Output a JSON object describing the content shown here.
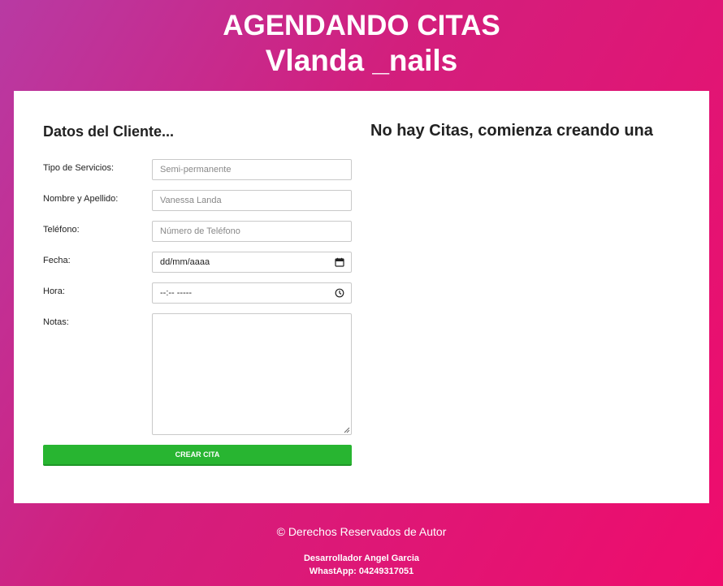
{
  "header": {
    "title": "AGENDANDO CITAS",
    "subtitle": "Vlanda _nails"
  },
  "form": {
    "heading": "Datos del Cliente...",
    "fields": [
      {
        "label": "Tipo de Servicios:",
        "placeholder": "Semi-permanente",
        "value": ""
      },
      {
        "label": "Nombre y Apellido:",
        "placeholder": "Vanessa Landa",
        "value": ""
      },
      {
        "label": "Teléfono:",
        "placeholder": "Número de Teléfono",
        "value": ""
      },
      {
        "label": "Fecha:",
        "placeholder": "dd/mm/aaaa",
        "value": "",
        "icon": "calendar-icon"
      },
      {
        "label": "Hora:",
        "placeholder": "--:-- -----",
        "value": "",
        "icon": "clock-icon"
      },
      {
        "label": "Notas:",
        "placeholder": "",
        "value": ""
      }
    ],
    "submit_label": "CREAR CITA",
    "submit_color": "#28b531"
  },
  "appointments": {
    "empty_message": "No hay Citas, comienza creando una"
  },
  "footer": {
    "copyright": "© Derechos Reservados de Autor",
    "developer": "Desarrollador Angel Garcia",
    "whatsapp": "WhastApp: 04249317051"
  },
  "colors": {
    "gradient_start": "#b83aa3",
    "gradient_end": "#ef0c6c",
    "card": "#ffffff"
  }
}
